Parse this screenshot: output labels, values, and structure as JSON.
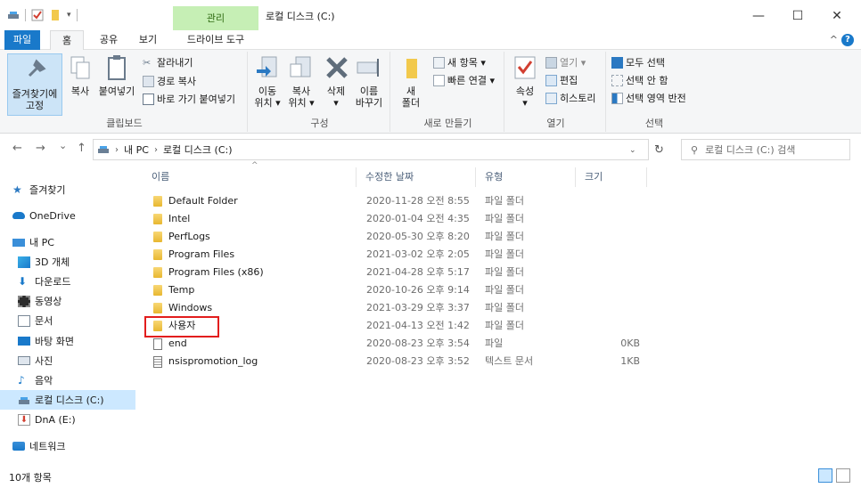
{
  "window": {
    "title": "로컬 디스크 (C:)",
    "contextual_tab": "관리",
    "minimize": "—",
    "maximize": "☐",
    "close": "✕"
  },
  "ribbon_tabs": {
    "file": "파일",
    "home": "홈",
    "share": "공유",
    "view": "보기",
    "drive_tools": "드라이브 도구",
    "collapse": "^",
    "help": "?"
  },
  "clipboard": {
    "pin_quick_access": "즐겨찾기에\n고정",
    "copy": "복사",
    "paste": "붙여넣기",
    "cut": "잘라내기",
    "copy_path": "경로 복사",
    "paste_shortcut": "바로 가기 붙여넣기",
    "group": "클립보드"
  },
  "organize": {
    "move_to": "이동\n위치 ▾",
    "copy_to": "복사\n위치 ▾",
    "delete": "삭제\n▾",
    "rename": "이름\n바꾸기",
    "group": "구성"
  },
  "new": {
    "new_folder": "새\n폴더",
    "new_item": "새 항목 ▾",
    "easy_access": "빠른 연결 ▾",
    "group": "새로 만들기"
  },
  "open": {
    "properties": "속성\n▾",
    "open": "열기 ▾",
    "edit": "편집",
    "history": "히스토리",
    "group": "열기"
  },
  "select": {
    "select_all": "모두 선택",
    "select_none": "선택 안 함",
    "invert_selection": "선택 영역 반전",
    "group": "선택"
  },
  "address": {
    "back": "←",
    "forward": "→",
    "recent": "⌄",
    "up": "↑",
    "crumbs": [
      "내 PC",
      "로컬 디스크 (C:)"
    ],
    "dropdown": "⌄",
    "refresh": "↻",
    "search_placeholder": "로컬 디스크 (C:) 검색"
  },
  "nav": {
    "quick_access": "즐겨찾기",
    "onedrive": "OneDrive",
    "this_pc": "내 PC",
    "objects_3d": "3D 개체",
    "downloads": "다운로드",
    "videos": "동영상",
    "documents": "문서",
    "desktop": "바탕 화면",
    "pictures": "사진",
    "music": "음악",
    "local_disk": "로컬 디스크 (C:)",
    "dna_drive": "DnA (E:)",
    "network": "네트워크"
  },
  "columns": {
    "name": "이름",
    "date": "수정한 날짜",
    "type": "유형",
    "size": "크기"
  },
  "files": [
    {
      "name": "Default Folder",
      "date": "2020-11-28 오전 8:55",
      "type": "파일 폴더",
      "size": "",
      "icon": "folder-icon"
    },
    {
      "name": "Intel",
      "date": "2020-01-04 오전 4:35",
      "type": "파일 폴더",
      "size": "",
      "icon": "folder-icon"
    },
    {
      "name": "PerfLogs",
      "date": "2020-05-30 오후 8:20",
      "type": "파일 폴더",
      "size": "",
      "icon": "folder-icon"
    },
    {
      "name": "Program Files",
      "date": "2021-03-02 오후 2:05",
      "type": "파일 폴더",
      "size": "",
      "icon": "folder-icon"
    },
    {
      "name": "Program Files (x86)",
      "date": "2021-04-28 오후 5:17",
      "type": "파일 폴더",
      "size": "",
      "icon": "folder-icon"
    },
    {
      "name": "Temp",
      "date": "2020-10-26 오후 9:14",
      "type": "파일 폴더",
      "size": "",
      "icon": "folder-icon"
    },
    {
      "name": "Windows",
      "date": "2021-03-29 오후 3:37",
      "type": "파일 폴더",
      "size": "",
      "icon": "folder-icon"
    },
    {
      "name": "사용자",
      "date": "2021-04-13 오전 1:42",
      "type": "파일 폴더",
      "size": "",
      "icon": "folder-icon"
    },
    {
      "name": "end",
      "date": "2020-08-23 오후 3:54",
      "type": "파일",
      "size": "0KB",
      "icon": "file-icon"
    },
    {
      "name": "nsispromotion_log",
      "date": "2020-08-23 오후 3:52",
      "type": "텍스트 문서",
      "size": "1KB",
      "icon": "text-file-icon"
    }
  ],
  "status": {
    "item_count": "10개 항목"
  },
  "colors": {
    "file_tab": "#1979ca",
    "manage_tab": "#c6efb5",
    "selection": "#cce8ff",
    "highlight": "#e21d1d"
  }
}
